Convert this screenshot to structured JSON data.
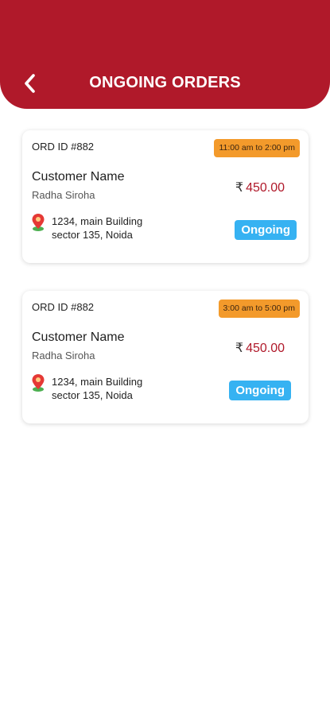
{
  "header": {
    "title": "ONGOING ORDERS",
    "back_icon": "chevron-left-icon"
  },
  "orders": [
    {
      "order_id": "ORD ID #882",
      "time_slot": "11:00 am to 2:00 pm",
      "customer_label": "Customer Name",
      "customer_name": "Radha Siroha",
      "currency": "₹",
      "amount": "450.00",
      "address_line1": "1234, main Building",
      "address_line2": "sector 135, Noida",
      "status": "Ongoing"
    },
    {
      "order_id": "ORD ID #882",
      "time_slot": "3:00 am to 5:00 pm",
      "customer_label": "Customer Name",
      "customer_name": "Radha Siroha",
      "currency": "₹",
      "amount": "450.00",
      "address_line1": "1234, main Building",
      "address_line2": "sector 135, Noida",
      "status": "Ongoing"
    }
  ],
  "colors": {
    "brand": "#b0192a",
    "time_badge": "#f39a2b",
    "status_badge": "#36b2f2",
    "price": "#b0192a"
  }
}
